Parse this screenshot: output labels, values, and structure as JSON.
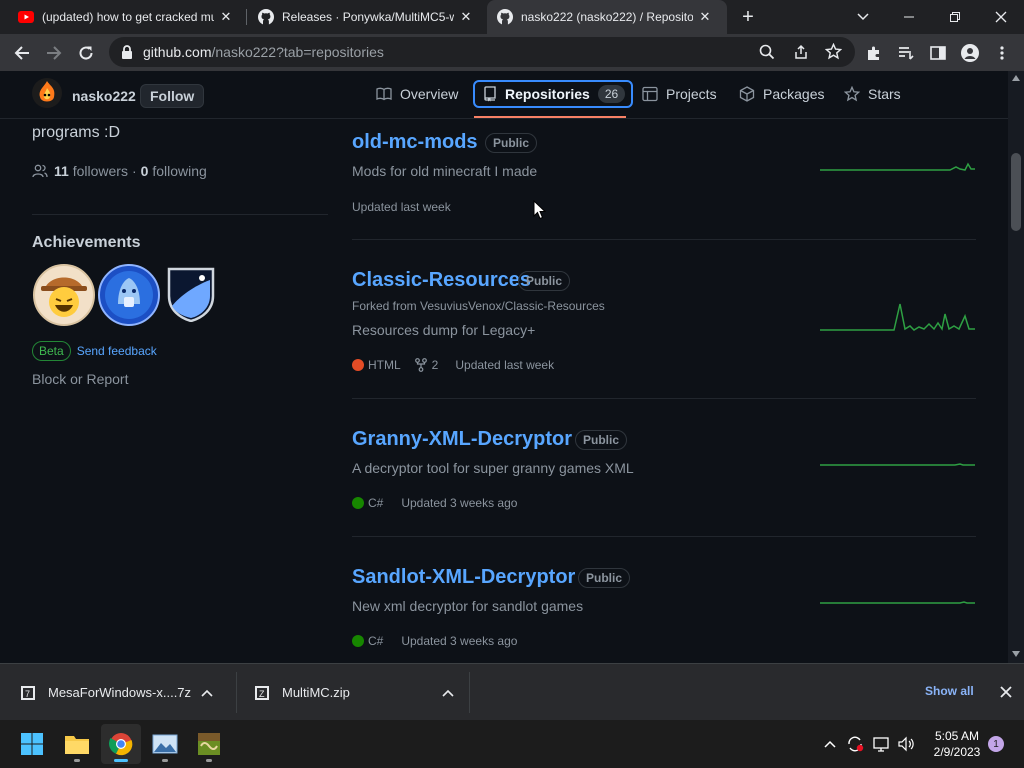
{
  "browser": {
    "tabs": [
      {
        "title": "(updated) how to get cracked mu",
        "icon": "youtube-icon",
        "active": false
      },
      {
        "title": "Releases · Ponywka/MultiMC5-wi",
        "icon": "github-icon",
        "active": false
      },
      {
        "title": "nasko222 (nasko222) / Repositor",
        "icon": "github-icon",
        "active": true
      }
    ],
    "url_host": "github.com",
    "url_path": "/nasko222?tab=repositories"
  },
  "profile": {
    "username": "nasko222",
    "follow_label": "Follow",
    "bio_tail": "programs :D",
    "followers_count": "11",
    "followers_label": "followers",
    "following_count": "0",
    "following_label": "following",
    "achievements_heading": "Achievements",
    "beta_label": "Beta",
    "feedback_label": "Send feedback",
    "block_label": "Block or Report"
  },
  "nav": {
    "overview": "Overview",
    "repositories": "Repositories",
    "repositories_count": "26",
    "projects": "Projects",
    "packages": "Packages",
    "stars": "Stars"
  },
  "repos": [
    {
      "name": "old-mc-mods",
      "visibility": "Public",
      "forked_from": "",
      "description": "Mods for old minecraft I made",
      "language": "",
      "forks": "",
      "updated": "Updated last week"
    },
    {
      "name": "Classic-Resources",
      "visibility": "Public",
      "forked_from": "Forked from VesuviusVenox/Classic-Resources",
      "description": "Resources dump for Legacy+",
      "language": "HTML",
      "forks": "2",
      "updated": "Updated last week"
    },
    {
      "name": "Granny-XML-Decryptor",
      "visibility": "Public",
      "forked_from": "",
      "description": "A decryptor tool for super granny games XML",
      "language": "C#",
      "forks": "",
      "updated": "Updated 3 weeks ago"
    },
    {
      "name": "Sandlot-XML-Decryptor",
      "visibility": "Public",
      "forked_from": "",
      "description": "New xml decryptor for sandlot games",
      "language": "C#",
      "forks": "",
      "updated": "Updated 3 weeks ago"
    }
  ],
  "colors": {
    "html": "#e34c26",
    "csharp": "#178600",
    "link": "#58a6ff",
    "accent_underline": "#f78166"
  },
  "downloads": {
    "items": [
      "MesaForWindows-x....7z",
      "MultiMC.zip"
    ],
    "show_all": "Show all"
  },
  "taskbar": {
    "time": "5:05 AM",
    "date": "2/9/2023",
    "notifications": "1"
  }
}
